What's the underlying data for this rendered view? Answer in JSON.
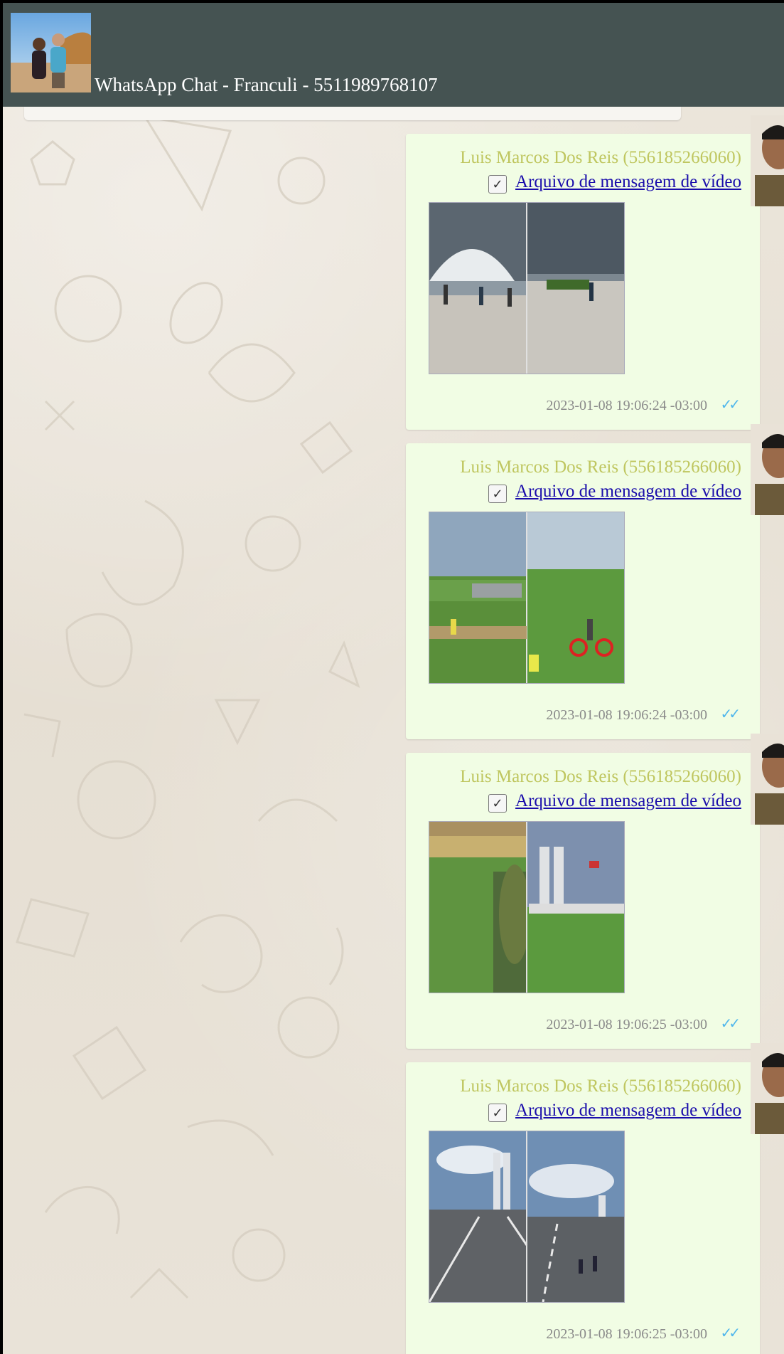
{
  "header": {
    "title": "WhatsApp Chat - Franculi - 5511989768107",
    "avatar_icon": "profile-photo-couple-beach"
  },
  "messages": [
    {
      "sender": "Luis Marcos Dos Reis (556185266060)",
      "attachment_label": "Arquivo de mensagem de vídeo",
      "checkbox_glyph": "✓",
      "timestamp": "2023-01-08 19:06:24 -03:00",
      "status_glyph": "✓✓",
      "thumbnail_icon": "video-thumbnail-congress-dome-crowd"
    },
    {
      "sender": "Luis Marcos Dos Reis (556185266060)",
      "attachment_label": "Arquivo de mensagem de vídeo",
      "checkbox_glyph": "✓",
      "timestamp": "2023-01-08 19:06:24 -03:00",
      "status_glyph": "✓✓",
      "thumbnail_icon": "video-thumbnail-lawn-bicycle-crowd"
    },
    {
      "sender": "Luis Marcos Dos Reis (556185266060)",
      "attachment_label": "Arquivo de mensagem de vídeo",
      "checkbox_glyph": "✓",
      "timestamp": "2023-01-08 19:06:25 -03:00",
      "status_glyph": "✓✓",
      "thumbnail_icon": "video-thumbnail-lawn-twin-towers"
    },
    {
      "sender": "Luis Marcos Dos Reis (556185266060)",
      "attachment_label": "Arquivo de mensagem de vídeo",
      "checkbox_glyph": "✓",
      "timestamp": "2023-01-08 19:06:25 -03:00",
      "status_glyph": "✓✓",
      "thumbnail_icon": "video-thumbnail-road-twin-towers"
    }
  ],
  "colors": {
    "header_bg": "#455352",
    "bubble_bg": "#f1fde4",
    "sender_name": "#bfc65f",
    "link": "#1a0dab",
    "read_ticks": "#4fb6ec",
    "wallpaper": "#e9e2d7"
  }
}
